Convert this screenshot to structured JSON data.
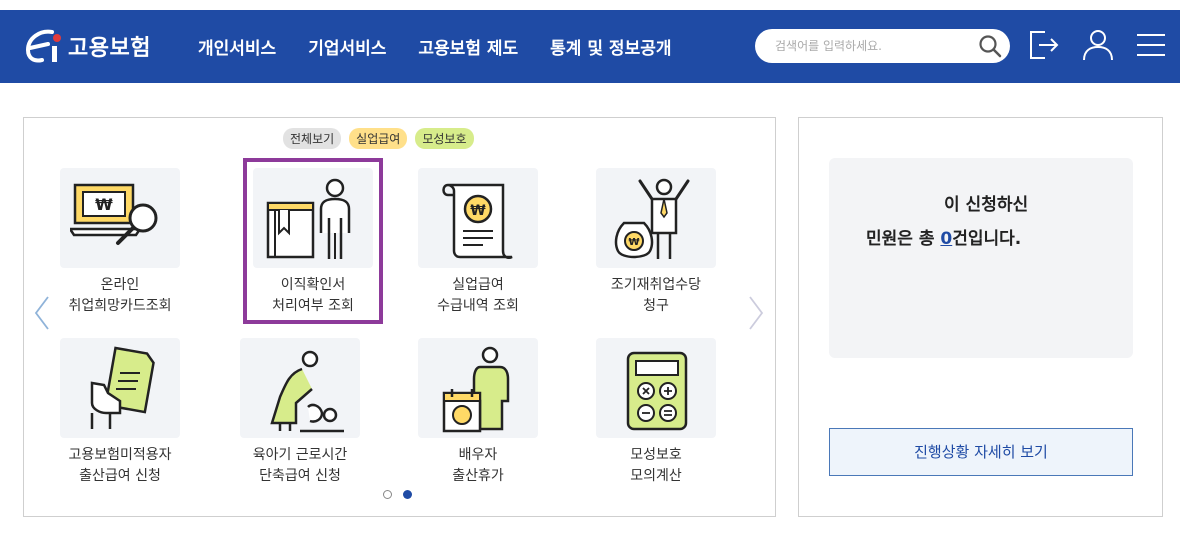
{
  "header": {
    "logo_text": "고용보험",
    "nav": [
      "개인서비스",
      "기업서비스",
      "고용보험 제도",
      "통계 및 정보공개"
    ],
    "search_placeholder": "검색어를 입력하세요.",
    "brand_color": "#1f4ba5",
    "icons": [
      "search-icon",
      "logout-icon",
      "user-icon",
      "menu-icon"
    ]
  },
  "filters": [
    "전체보기",
    "실업급여",
    "모성보호"
  ],
  "services": [
    {
      "line1": "온라인",
      "line2": "취업희망카드조회",
      "icon": "laptop-won-magnifier-icon"
    },
    {
      "line1": "이직확인서",
      "line2": "처리여부 조회",
      "icon": "book-person-icon",
      "highlighted": true
    },
    {
      "line1": "실업급여",
      "line2": "수급내역 조회",
      "icon": "won-document-scroll-icon"
    },
    {
      "line1": "조기재취업수당",
      "line2": "청구",
      "icon": "cheering-person-money-bag-icon"
    },
    {
      "line1": "고용보험미적용자",
      "line2": "출산급여 신청",
      "icon": "hand-document-icon"
    },
    {
      "line1": "육아기 근로시간",
      "line2": "단축급여 신청",
      "icon": "parent-baby-icon"
    },
    {
      "line1": "배우자",
      "line2": "출산휴가",
      "icon": "calendar-baby-person-icon"
    },
    {
      "line1": "모성보호",
      "line2": "모의계산",
      "icon": "calculator-icon"
    }
  ],
  "pagination": {
    "pages": 2,
    "current": 2
  },
  "status": {
    "line1": "이 신청하신",
    "line2_prefix": "민원은 총 ",
    "count": "0",
    "line2_suffix": "건입니다."
  },
  "detail_button": "진행상황 자세히 보기"
}
